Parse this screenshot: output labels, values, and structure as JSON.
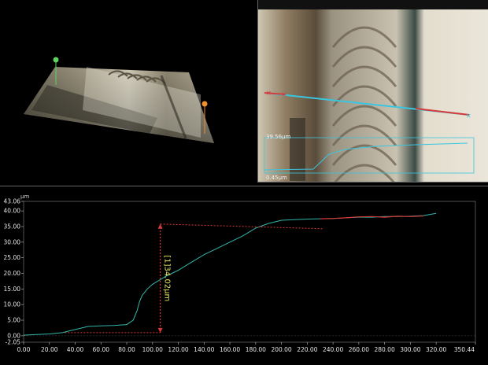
{
  "colors": {
    "profile_line": "#2fb8a8",
    "reference_line": "#d63a3a",
    "measure_cyan": "#39c6e0",
    "annotation": "#e8e860",
    "marker_green": "#5ed15e",
    "marker_orange": "#f0902a"
  },
  "view3d": {
    "markers": [
      "green-point",
      "orange-point"
    ]
  },
  "micro": {
    "label_top": "39.56µm",
    "label_bottom": "0.45µm"
  },
  "profile": {
    "annotation": "[1]34.02µm"
  },
  "chart_data": {
    "type": "line",
    "xunit": "",
    "yunit": "µm",
    "xlim": [
      0.0,
      350.44
    ],
    "ylim": [
      -2.05,
      43.06
    ],
    "x_ticks": [
      "0.00",
      "20.00",
      "40.00",
      "60.00",
      "80.00",
      "100.00",
      "120.00",
      "140.00",
      "160.00",
      "180.00",
      "200.00",
      "220.00",
      "240.00",
      "260.00",
      "280.00",
      "300.00",
      "320.00",
      "350.44"
    ],
    "x_tick_values": [
      0,
      20,
      40,
      60,
      80,
      100,
      120,
      140,
      160,
      180,
      200,
      220,
      240,
      260,
      280,
      300,
      320,
      350.44
    ],
    "y_ticks": [
      "43.06",
      "40.00",
      "35.00",
      "30.00",
      "25.00",
      "20.00",
      "15.00",
      "10.00",
      "5.00",
      "0.00",
      "-2.05"
    ],
    "y_tick_values": [
      43.06,
      40,
      35,
      30,
      25,
      20,
      15,
      10,
      5,
      0,
      -2.05
    ],
    "series": [
      {
        "x": [
          0,
          10,
          20,
          30,
          40,
          50,
          60,
          70,
          80,
          85,
          88,
          90,
          92,
          94,
          96,
          100,
          110,
          120,
          130,
          140,
          150,
          160,
          170,
          180,
          190,
          200,
          210,
          220,
          230,
          240,
          250,
          260,
          270,
          280,
          290,
          300,
          310,
          320
        ],
        "y": [
          0.2,
          0.4,
          0.6,
          1.0,
          2.0,
          3.0,
          3.2,
          3.3,
          3.6,
          5.0,
          8.0,
          11.0,
          13.0,
          14.0,
          15.0,
          16.5,
          19.0,
          21.0,
          23.5,
          26.0,
          28.0,
          30.0,
          32.0,
          34.5,
          36.0,
          37.0,
          37.2,
          37.4,
          37.5,
          37.6,
          37.8,
          38.0,
          38.0,
          38.2,
          38.2,
          38.3,
          38.5,
          39.2
        ]
      },
      {
        "x": [
          230,
          240,
          250,
          260,
          270,
          280,
          290,
          300,
          310
        ],
        "y": [
          37.5,
          37.6,
          37.8,
          38.1,
          38.2,
          38.0,
          38.3,
          38.2,
          38.4
        ]
      }
    ],
    "measurement": {
      "x": 106,
      "y_low": 1.0,
      "y_high": 35.8,
      "ref_low_x": [
        32,
        106
      ],
      "ref_high_x": [
        106,
        232
      ]
    }
  }
}
